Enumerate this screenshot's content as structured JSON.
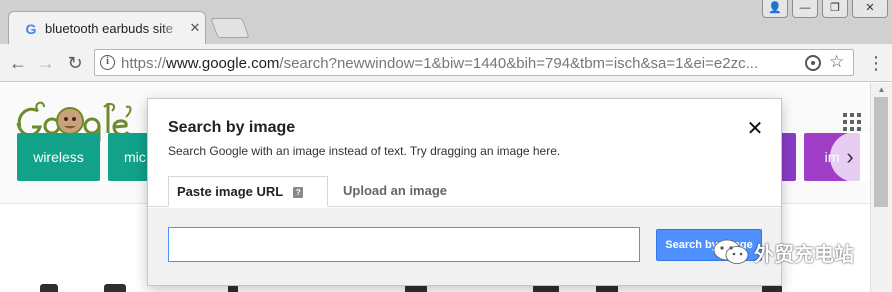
{
  "browser": {
    "tab": {
      "title": "bluetooth earbuds site",
      "favicon": "G",
      "close_glyph": "✕"
    },
    "window_controls": {
      "user": "👤",
      "minimize": "—",
      "maximize": "❐",
      "close": "✕"
    },
    "nav": {
      "back": "←",
      "forward": "→",
      "reload": "↻"
    },
    "omnibox": {
      "info": "i",
      "url_scheme": "https://",
      "url_host": "www.google.com",
      "url_path": "/search?newwindow=1&biw=1440&bih=794&tbm=isch&sa=1&ei=e2zc..."
    },
    "star": "☆",
    "menu": "⋮"
  },
  "page": {
    "chips": {
      "wireless": "wireless",
      "mic": "mic",
      "purple_b": "im"
    },
    "chip_next": "›",
    "colors": {
      "chip_teal": "#12a189",
      "chip_purple": "#8a3bc6",
      "accent_blue": "#4d90fe"
    }
  },
  "modal": {
    "title": "Search by image",
    "description": "Search Google with an image instead of text. Try dragging an image here.",
    "close": "✕",
    "tabs": {
      "paste": "Paste image URL",
      "paste_help": "?",
      "upload": "Upload an image"
    },
    "url_input": {
      "value": "",
      "placeholder": ""
    },
    "search_button": "Search by image"
  },
  "watermark": {
    "text": "外贸充电站"
  },
  "scrollbar": {
    "up": "▲"
  }
}
